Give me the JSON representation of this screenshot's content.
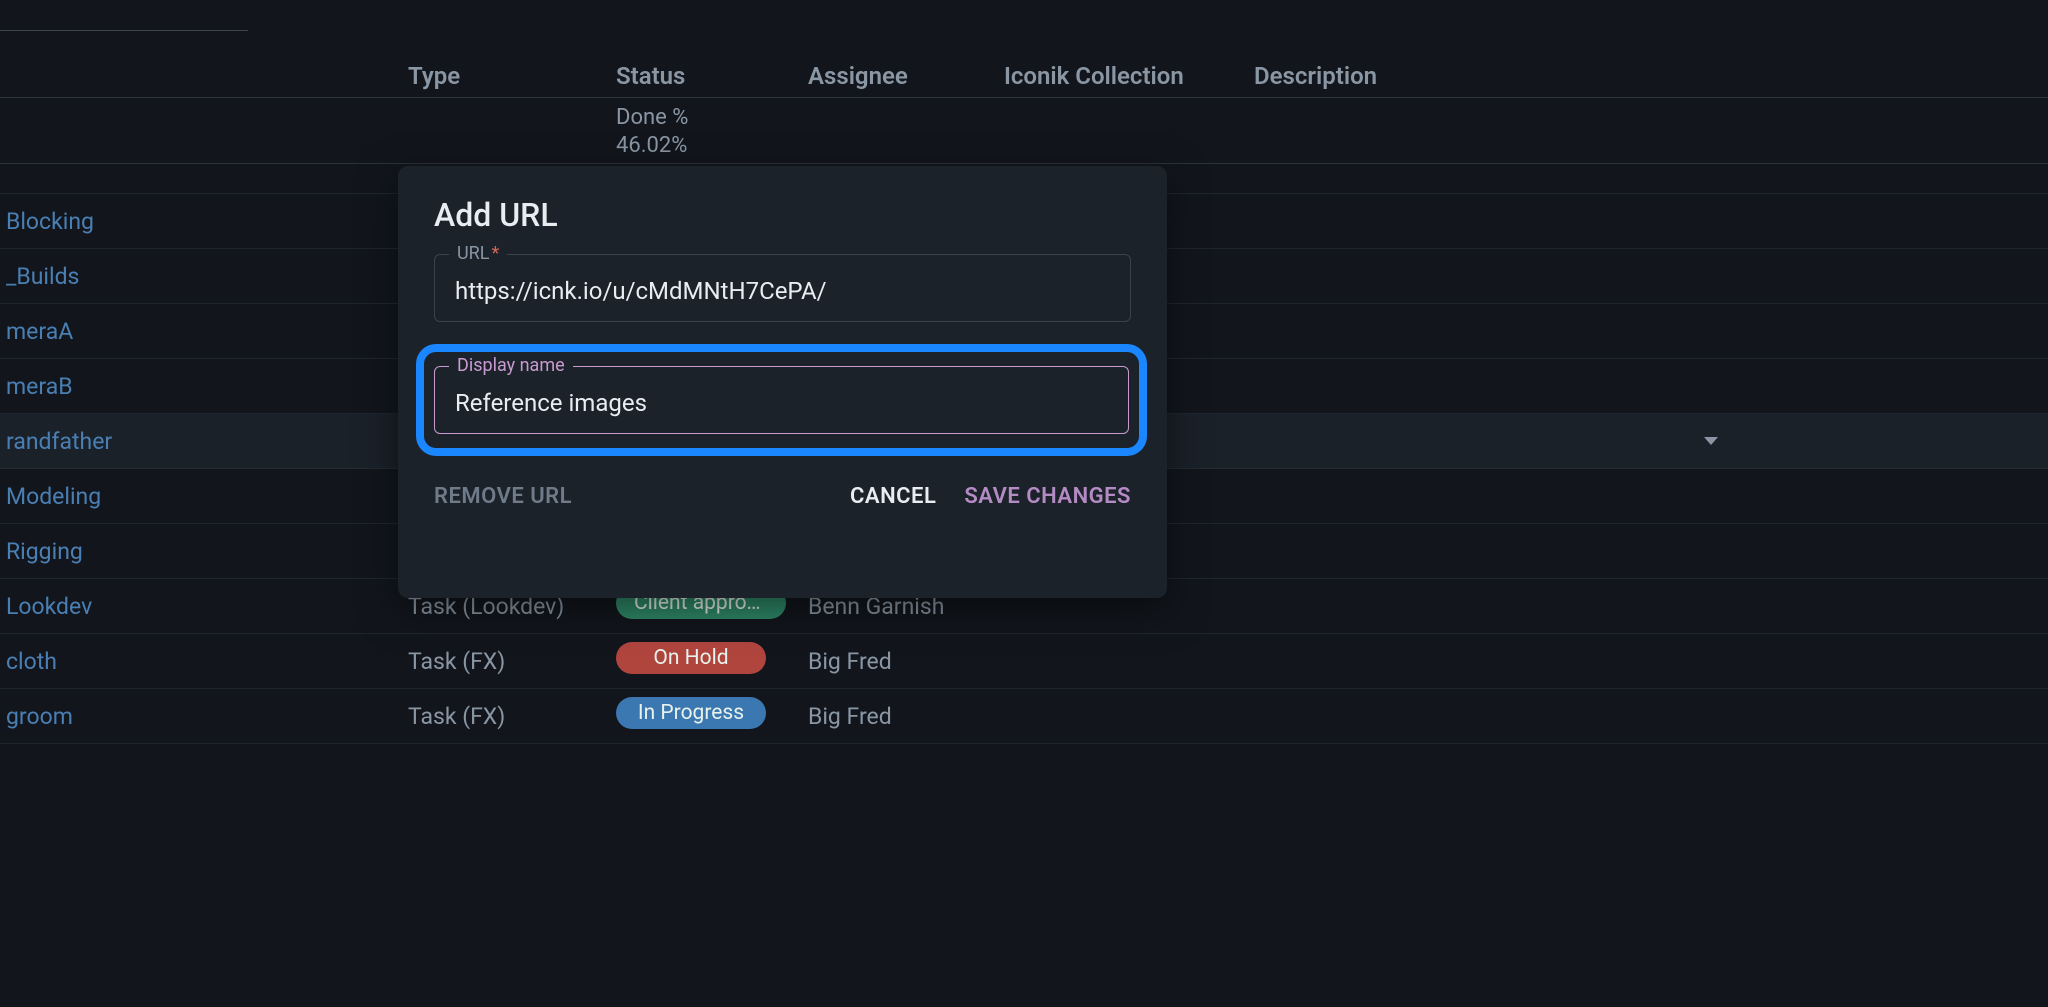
{
  "headers": {
    "type": "Type",
    "status": "Status",
    "assignee": "Assignee",
    "iconik": "Iconik Collection",
    "description": "Description"
  },
  "summary": {
    "done_label": "Done %",
    "done_value": "46.02%"
  },
  "rows": [
    {
      "name": " Blocking",
      "type": "",
      "status": null,
      "assignee": ""
    },
    {
      "name": "_Builds",
      "type": "",
      "status": null,
      "assignee": ""
    },
    {
      "name": "meraA",
      "type": "",
      "status": null,
      "assignee": ""
    },
    {
      "name": "meraB",
      "type": "",
      "status": null,
      "assignee": ""
    },
    {
      "name": "randfather",
      "type": "",
      "status": null,
      "assignee": "",
      "selected": true,
      "has_caret": true
    },
    {
      "name": "Modeling",
      "type": "",
      "status": null,
      "assignee": ""
    },
    {
      "name": "Rigging",
      "type": "",
      "status": null,
      "assignee": ""
    },
    {
      "name": "Lookdev",
      "type": "Task (Lookdev)",
      "status": {
        "text": "Client approv…",
        "cls": "green"
      },
      "assignee": "Benn Garnish"
    },
    {
      "name": "cloth",
      "type": "Task (FX)",
      "status": {
        "text": "On Hold",
        "cls": "red"
      },
      "assignee": "Big Fred"
    },
    {
      "name": "groom",
      "type": "Task (FX)",
      "status": {
        "text": "In Progress",
        "cls": "blue"
      },
      "assignee": "Big Fred"
    }
  ],
  "modal": {
    "title": "Add URL",
    "url_label": "URL",
    "url_required_mark": "*",
    "url_value": "https://icnk.io/u/cMdMNtH7CePA/",
    "display_name_label": "Display name",
    "display_name_value": "Reference images",
    "remove_label": "REMOVE URL",
    "cancel_label": "CANCEL",
    "save_label": "SAVE CHANGES"
  }
}
